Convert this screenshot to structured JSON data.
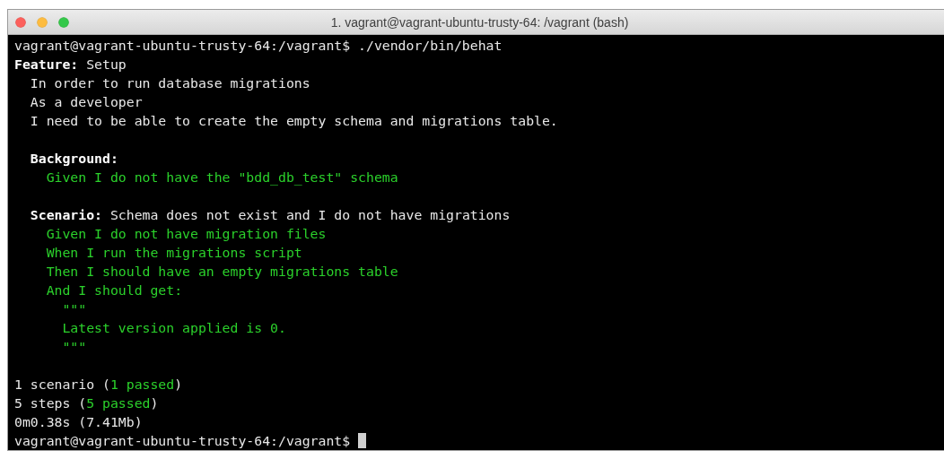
{
  "window": {
    "title": "1. vagrant@vagrant-ubuntu-trusty-64: /vagrant (bash)"
  },
  "terminal": {
    "blocks": [
      {
        "lines": [
          {
            "segments": [
              {
                "text": "vagrant@vagrant-ubuntu-trusty-64:/vagrant$ ./vendor/bin/behat",
                "bold": false,
                "color": "#e8e8e8"
              }
            ]
          },
          {
            "segments": [
              {
                "text": "Feature:",
                "bold": true,
                "color": "#ffffff"
              },
              {
                "text": " Setup",
                "bold": false,
                "color": "#e8e8e8"
              }
            ]
          },
          {
            "segments": [
              {
                "text": "  In order to run database migrations",
                "bold": false,
                "color": "#e8e8e8"
              }
            ]
          },
          {
            "segments": [
              {
                "text": "  As a developer",
                "bold": false,
                "color": "#e8e8e8"
              }
            ]
          },
          {
            "segments": [
              {
                "text": "  I need to be able to create the empty schema and migrations table.",
                "bold": false,
                "color": "#e8e8e8"
              }
            ]
          }
        ]
      },
      {
        "lines": [
          {
            "segments": [
              {
                "text": "  Background:",
                "bold": true,
                "color": "#ffffff"
              }
            ]
          },
          {
            "segments": [
              {
                "text": "    Given I do not have the \"bdd_db_test\" schema",
                "bold": false,
                "color": "#2bd12b"
              }
            ]
          }
        ]
      },
      {
        "lines": [
          {
            "segments": [
              {
                "text": "  Scenario:",
                "bold": true,
                "color": "#ffffff"
              },
              {
                "text": " Schema does not exist and I do not have migrations",
                "bold": false,
                "color": "#e8e8e8"
              }
            ]
          },
          {
            "segments": [
              {
                "text": "    Given I do not have migration files",
                "bold": false,
                "color": "#2bd12b"
              }
            ]
          },
          {
            "segments": [
              {
                "text": "    When I run the migrations script",
                "bold": false,
                "color": "#2bd12b"
              }
            ]
          },
          {
            "segments": [
              {
                "text": "    Then I should have an empty migrations table",
                "bold": false,
                "color": "#2bd12b"
              }
            ]
          },
          {
            "segments": [
              {
                "text": "    And I should get:",
                "bold": false,
                "color": "#2bd12b"
              }
            ]
          },
          {
            "segments": [
              {
                "text": "      \"\"\"",
                "bold": false,
                "color": "#2bd12b"
              }
            ]
          },
          {
            "segments": [
              {
                "text": "      Latest version applied is 0.",
                "bold": false,
                "color": "#2bd12b"
              }
            ]
          },
          {
            "segments": [
              {
                "text": "      \"\"\"",
                "bold": false,
                "color": "#2bd12b"
              }
            ]
          }
        ]
      },
      {
        "lines": [
          {
            "segments": [
              {
                "text": "1 scenario (",
                "bold": false,
                "color": "#e8e8e8"
              },
              {
                "text": "1 passed",
                "bold": false,
                "color": "#2bd12b"
              },
              {
                "text": ")",
                "bold": false,
                "color": "#e8e8e8"
              }
            ]
          },
          {
            "segments": [
              {
                "text": "5 steps (",
                "bold": false,
                "color": "#e8e8e8"
              },
              {
                "text": "5 passed",
                "bold": false,
                "color": "#2bd12b"
              },
              {
                "text": ")",
                "bold": false,
                "color": "#e8e8e8"
              }
            ]
          },
          {
            "segments": [
              {
                "text": "0m0.38s (7.41Mb)",
                "bold": false,
                "color": "#e8e8e8"
              }
            ]
          },
          {
            "segments": [
              {
                "text": "vagrant@vagrant-ubuntu-trusty-64:/vagrant$ ",
                "bold": false,
                "color": "#e8e8e8"
              }
            ]
          }
        ]
      }
    ]
  }
}
